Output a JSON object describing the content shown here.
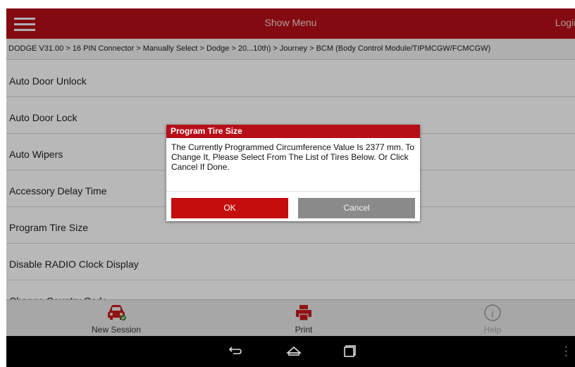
{
  "header": {
    "title": "Show Menu",
    "login_label": "Login"
  },
  "breadcrumb": "DODGE V31.00 > 16 PIN Connector > Manually Select > Dodge > 20...10th) > Journey > BCM (Body Control Module/TIPMCGW/FCMCGW)",
  "menu_items": [
    "Auto Door Unlock",
    "Auto Door Lock",
    "Auto Wipers",
    "Accessory Delay Time",
    "Program Tire Size",
    "Disable RADIO Clock Display",
    "Change Country Code"
  ],
  "dialog": {
    "title": "Program Tire Size",
    "message": "The Currently Programmed Circumference Value Is 2377 mm. To Change It, Please Select From The List of Tires Below. Or Click Cancel If Done.",
    "ok_label": "OK",
    "cancel_label": "Cancel"
  },
  "bottom_nav": {
    "new_session": "New Session",
    "print": "Print",
    "help": "Help"
  },
  "icons": {
    "menu": "hamburger-icon",
    "new_session": "car-icon",
    "print": "printer-icon",
    "help": "info-icon",
    "back": "back-icon",
    "home": "home-icon",
    "recents": "recents-icon",
    "overflow": "overflow-menu-icon"
  },
  "colors": {
    "brand": "#b70f18",
    "ok_button": "#c40d0d",
    "cancel_button": "#8a8a8a"
  }
}
